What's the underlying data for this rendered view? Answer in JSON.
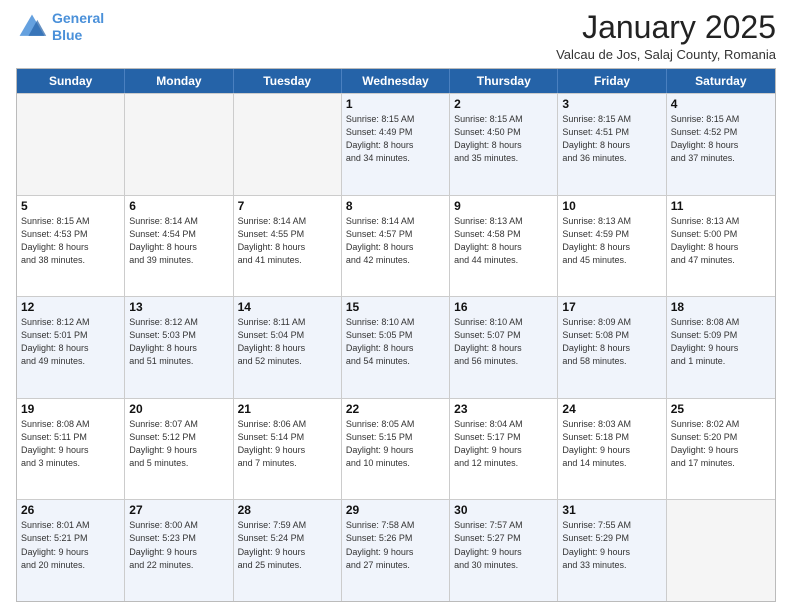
{
  "header": {
    "logo_line1": "General",
    "logo_line2": "Blue",
    "title": "January 2025",
    "subtitle": "Valcau de Jos, Salaj County, Romania"
  },
  "calendar": {
    "days_of_week": [
      "Sunday",
      "Monday",
      "Tuesday",
      "Wednesday",
      "Thursday",
      "Friday",
      "Saturday"
    ],
    "rows": [
      [
        {
          "day": "",
          "info": "",
          "empty": true
        },
        {
          "day": "",
          "info": "",
          "empty": true
        },
        {
          "day": "",
          "info": "",
          "empty": true
        },
        {
          "day": "1",
          "info": "Sunrise: 8:15 AM\nSunset: 4:49 PM\nDaylight: 8 hours\nand 34 minutes."
        },
        {
          "day": "2",
          "info": "Sunrise: 8:15 AM\nSunset: 4:50 PM\nDaylight: 8 hours\nand 35 minutes."
        },
        {
          "day": "3",
          "info": "Sunrise: 8:15 AM\nSunset: 4:51 PM\nDaylight: 8 hours\nand 36 minutes."
        },
        {
          "day": "4",
          "info": "Sunrise: 8:15 AM\nSunset: 4:52 PM\nDaylight: 8 hours\nand 37 minutes."
        }
      ],
      [
        {
          "day": "5",
          "info": "Sunrise: 8:15 AM\nSunset: 4:53 PM\nDaylight: 8 hours\nand 38 minutes."
        },
        {
          "day": "6",
          "info": "Sunrise: 8:14 AM\nSunset: 4:54 PM\nDaylight: 8 hours\nand 39 minutes."
        },
        {
          "day": "7",
          "info": "Sunrise: 8:14 AM\nSunset: 4:55 PM\nDaylight: 8 hours\nand 41 minutes."
        },
        {
          "day": "8",
          "info": "Sunrise: 8:14 AM\nSunset: 4:57 PM\nDaylight: 8 hours\nand 42 minutes."
        },
        {
          "day": "9",
          "info": "Sunrise: 8:13 AM\nSunset: 4:58 PM\nDaylight: 8 hours\nand 44 minutes."
        },
        {
          "day": "10",
          "info": "Sunrise: 8:13 AM\nSunset: 4:59 PM\nDaylight: 8 hours\nand 45 minutes."
        },
        {
          "day": "11",
          "info": "Sunrise: 8:13 AM\nSunset: 5:00 PM\nDaylight: 8 hours\nand 47 minutes."
        }
      ],
      [
        {
          "day": "12",
          "info": "Sunrise: 8:12 AM\nSunset: 5:01 PM\nDaylight: 8 hours\nand 49 minutes."
        },
        {
          "day": "13",
          "info": "Sunrise: 8:12 AM\nSunset: 5:03 PM\nDaylight: 8 hours\nand 51 minutes."
        },
        {
          "day": "14",
          "info": "Sunrise: 8:11 AM\nSunset: 5:04 PM\nDaylight: 8 hours\nand 52 minutes."
        },
        {
          "day": "15",
          "info": "Sunrise: 8:10 AM\nSunset: 5:05 PM\nDaylight: 8 hours\nand 54 minutes."
        },
        {
          "day": "16",
          "info": "Sunrise: 8:10 AM\nSunset: 5:07 PM\nDaylight: 8 hours\nand 56 minutes."
        },
        {
          "day": "17",
          "info": "Sunrise: 8:09 AM\nSunset: 5:08 PM\nDaylight: 8 hours\nand 58 minutes."
        },
        {
          "day": "18",
          "info": "Sunrise: 8:08 AM\nSunset: 5:09 PM\nDaylight: 9 hours\nand 1 minute."
        }
      ],
      [
        {
          "day": "19",
          "info": "Sunrise: 8:08 AM\nSunset: 5:11 PM\nDaylight: 9 hours\nand 3 minutes."
        },
        {
          "day": "20",
          "info": "Sunrise: 8:07 AM\nSunset: 5:12 PM\nDaylight: 9 hours\nand 5 minutes."
        },
        {
          "day": "21",
          "info": "Sunrise: 8:06 AM\nSunset: 5:14 PM\nDaylight: 9 hours\nand 7 minutes."
        },
        {
          "day": "22",
          "info": "Sunrise: 8:05 AM\nSunset: 5:15 PM\nDaylight: 9 hours\nand 10 minutes."
        },
        {
          "day": "23",
          "info": "Sunrise: 8:04 AM\nSunset: 5:17 PM\nDaylight: 9 hours\nand 12 minutes."
        },
        {
          "day": "24",
          "info": "Sunrise: 8:03 AM\nSunset: 5:18 PM\nDaylight: 9 hours\nand 14 minutes."
        },
        {
          "day": "25",
          "info": "Sunrise: 8:02 AM\nSunset: 5:20 PM\nDaylight: 9 hours\nand 17 minutes."
        }
      ],
      [
        {
          "day": "26",
          "info": "Sunrise: 8:01 AM\nSunset: 5:21 PM\nDaylight: 9 hours\nand 20 minutes."
        },
        {
          "day": "27",
          "info": "Sunrise: 8:00 AM\nSunset: 5:23 PM\nDaylight: 9 hours\nand 22 minutes."
        },
        {
          "day": "28",
          "info": "Sunrise: 7:59 AM\nSunset: 5:24 PM\nDaylight: 9 hours\nand 25 minutes."
        },
        {
          "day": "29",
          "info": "Sunrise: 7:58 AM\nSunset: 5:26 PM\nDaylight: 9 hours\nand 27 minutes."
        },
        {
          "day": "30",
          "info": "Sunrise: 7:57 AM\nSunset: 5:27 PM\nDaylight: 9 hours\nand 30 minutes."
        },
        {
          "day": "31",
          "info": "Sunrise: 7:55 AM\nSunset: 5:29 PM\nDaylight: 9 hours\nand 33 minutes."
        },
        {
          "day": "",
          "info": "",
          "empty": true
        }
      ]
    ]
  }
}
